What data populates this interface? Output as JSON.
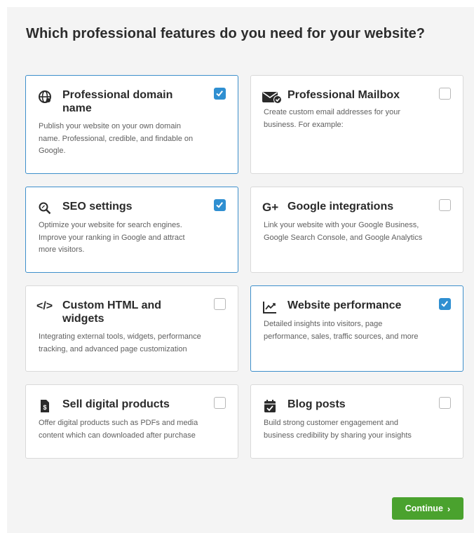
{
  "page": {
    "title": "Which professional features do you need for your website?"
  },
  "features": [
    {
      "title_line1": "Professional domain",
      "title_line2": "name",
      "description_line1": "Publish your website on your own domain",
      "description_line2": "name. Professional, credible, and findable on",
      "description_line3": "Google.",
      "icon": "globe-network-icon",
      "checked": true
    },
    {
      "title_line1": "Professional Mailbox",
      "description_line1": "Create custom email addresses for your",
      "description_line2": "business. For example:",
      "icon": "mail-check-icon",
      "checked": false
    },
    {
      "title_line1": "SEO settings",
      "description_line1": "Optimize your website for search engines.",
      "description_line2": "Improve your ranking in Google and attract",
      "description_line3": "more visitors.",
      "icon": "magnifier-icon",
      "checked": true
    },
    {
      "title_line1": "Google integrations",
      "icon_text": "G+",
      "description_line1": "Link your website with your Google Business,",
      "description_line2": "Google Search Console, and Google Analytics",
      "icon": "google-plus-icon",
      "checked": false
    },
    {
      "title_line1": "Custom HTML and",
      "title_line2": "widgets",
      "description_line1": "Integrating external tools, widgets, performance",
      "description_line2": "tracking, and advanced page customization",
      "icon": "code-icon",
      "icon_text": "</>",
      "checked": false
    },
    {
      "title_line1": "Website performance",
      "description_line1": "Detailed insights into visitors, page",
      "description_line2": "performance, sales, traffic sources, and more",
      "icon": "trend-chart-icon",
      "checked": true
    },
    {
      "title_line1": "Sell digital products",
      "description_line1": "Offer digital products such as PDFs and media",
      "description_line2": "content which can downloaded after purchase",
      "icon": "dollar-document-icon",
      "checked": false
    },
    {
      "title_line1": "Blog posts",
      "description_line1": "Build strong customer engagement and",
      "description_line2": "business credibility by sharing your insights",
      "icon": "calendar-check-icon",
      "checked": false
    }
  ],
  "actions": {
    "continue_label": "Continue",
    "continue_icon": "chevron-right-icon"
  },
  "colors": {
    "accent_blue": "#3d8fcb",
    "checkbox_blue": "#2f8fd1",
    "continue_green": "#4aa22e",
    "panel_bg": "#f4f4f4"
  }
}
